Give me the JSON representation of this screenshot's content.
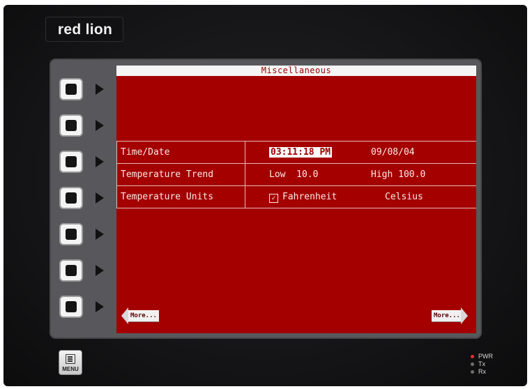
{
  "device": {
    "logo_text": "red lion"
  },
  "screen": {
    "title": "Miscellaneous",
    "rows": [
      {
        "label": "Time/Date",
        "value1": "03:11:18 PM",
        "value2": "09/08/04"
      },
      {
        "label": "Temperature Trend",
        "value1": "Low  10.0",
        "value2": "High 100.0"
      },
      {
        "label": "Temperature Units",
        "value1": "Fahrenheit",
        "value1_checked": true,
        "value2": "Celsius"
      }
    ],
    "more_left_label": "More...",
    "more_right_label": "More..."
  },
  "softkeys": [
    "softkey-1",
    "softkey-2",
    "softkey-3",
    "softkey-4",
    "softkey-5",
    "softkey-6",
    "softkey-7"
  ],
  "menu": {
    "label": "MENU"
  },
  "leds": [
    {
      "label": "PWR",
      "color": "#e03030"
    },
    {
      "label": "Tx",
      "color": "#707070"
    },
    {
      "label": "Rx",
      "color": "#707070"
    }
  ],
  "colors": {
    "screen_background": "#a40000",
    "screen_text": "#fbe8e8",
    "title_bar": "#f5f5f5"
  }
}
